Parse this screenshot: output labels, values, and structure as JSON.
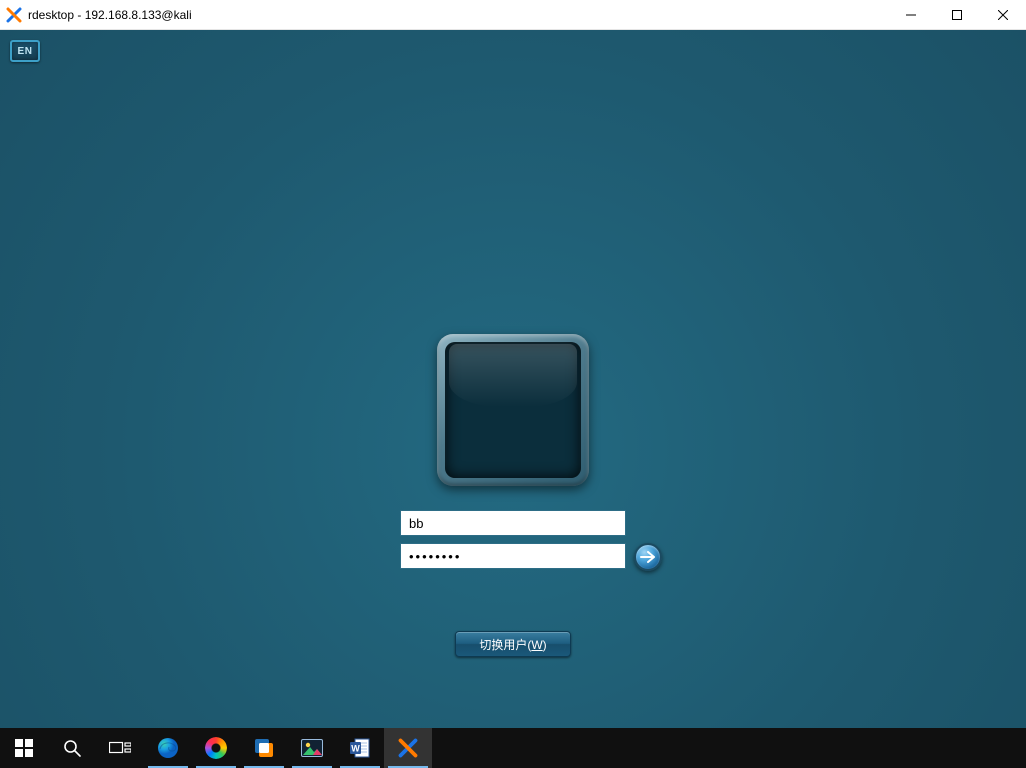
{
  "host_window": {
    "title": "rdesktop - 192.168.8.133@kali",
    "controls": {
      "minimize": "Minimize",
      "maximize": "Maximize",
      "close": "Close"
    }
  },
  "remote_session": {
    "language_badge": "EN",
    "login": {
      "username_value": "bb",
      "password_value": "••••••••",
      "submit_hint": "Submit",
      "switch_user_label": "切换用户",
      "switch_user_shortcut": "W"
    }
  },
  "taskbar": {
    "items": [
      {
        "name": "start-button",
        "label": "Start"
      },
      {
        "name": "search-button",
        "label": "Search"
      },
      {
        "name": "task-view-button",
        "label": "Task View"
      },
      {
        "name": "edge-browser",
        "label": "Microsoft Edge"
      },
      {
        "name": "chrome-browser",
        "label": "Chrome"
      },
      {
        "name": "vmware-workstation",
        "label": "VMware Workstation"
      },
      {
        "name": "image-viewer",
        "label": "Image Viewer"
      },
      {
        "name": "word-app",
        "label": "Microsoft Word"
      },
      {
        "name": "mobaxterm-app",
        "label": "MobaXterm"
      }
    ]
  }
}
